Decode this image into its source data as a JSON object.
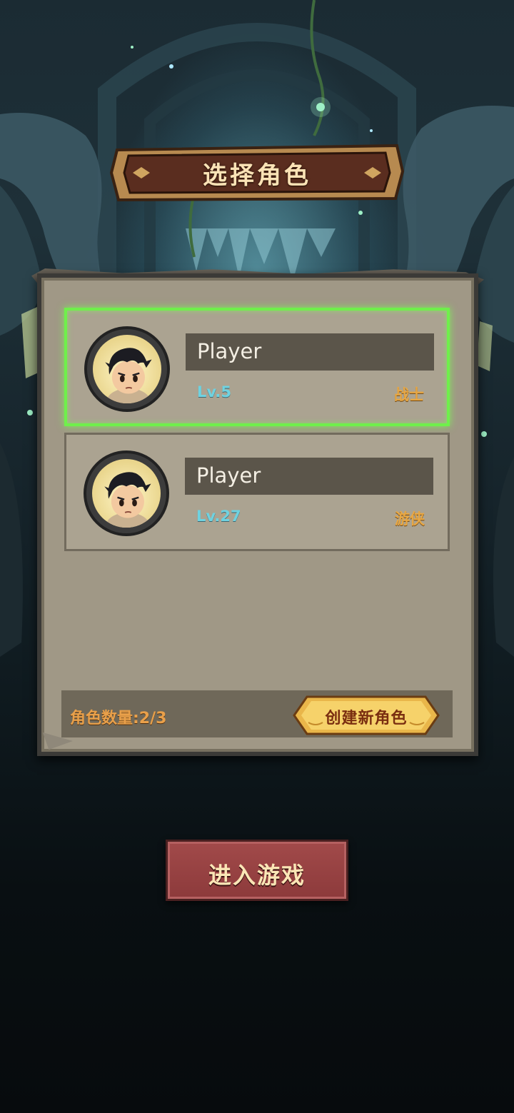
{
  "screen": {
    "title": "选择角色"
  },
  "characters": [
    {
      "name": "Player",
      "level": "Lv.5",
      "class": "战士",
      "selected": true
    },
    {
      "name": "Player",
      "level": "Lv.27",
      "class": "游侠",
      "selected": false
    }
  ],
  "footer": {
    "count_label": "角色数量:2/3",
    "create_button": "创建新角色"
  },
  "enter_button": "进入游戏",
  "colors": {
    "selection_glow": "#6ff04b",
    "level": "#6fd2e0",
    "class": "#e7a744",
    "enter_button": "#9a4444"
  }
}
